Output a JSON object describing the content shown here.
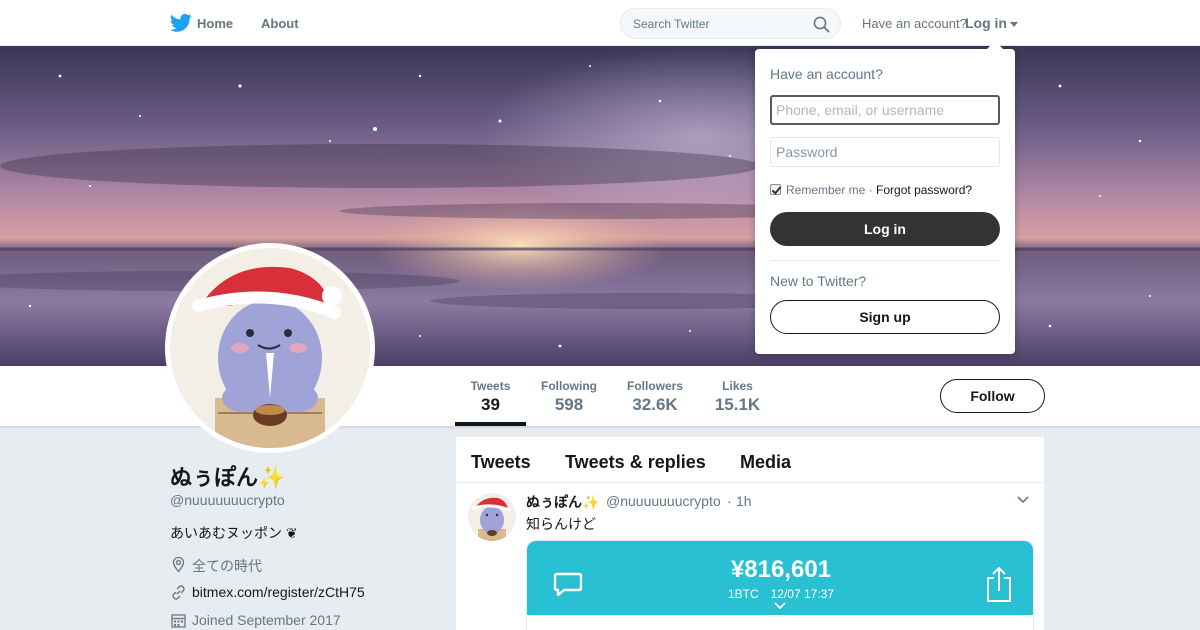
{
  "topbar": {
    "logo_icon": "twitter-bird-icon",
    "nav": [
      {
        "label": "Home"
      },
      {
        "label": "About"
      }
    ],
    "search_placeholder": "Search Twitter",
    "search_icon": "search-icon",
    "have_account": "Have an account?",
    "login_label": "Log in"
  },
  "login_dropdown": {
    "title": "Have an account?",
    "username_placeholder": "Phone, email, or username",
    "password_placeholder": "Password",
    "remember_me": "Remember me",
    "separator": "·",
    "forgot_password": "Forgot password?",
    "login_button": "Log in",
    "new_to_twitter": "New to Twitter?",
    "signup_button": "Sign up"
  },
  "profile_nav": {
    "stats": [
      {
        "label": "Tweets",
        "value": "39"
      },
      {
        "label": "Following",
        "value": "598"
      },
      {
        "label": "Followers",
        "value": "32.6K"
      },
      {
        "label": "Likes",
        "value": "15.1K"
      }
    ],
    "follow_button": "Follow"
  },
  "profile": {
    "name": "ぬぅぽん✨",
    "handle": "@nuuuuuuucrypto",
    "bio": "あいあむヌッポン ❦",
    "location": "全ての時代",
    "location_icon": "location-pin-icon",
    "url": "bitmex.com/register/zCtH75",
    "url_icon": "link-icon",
    "joined": "Joined September 2017",
    "joined_icon": "calendar-icon"
  },
  "timeline": {
    "tabs": [
      {
        "label": "Tweets"
      },
      {
        "label": "Tweets & replies"
      },
      {
        "label": "Media"
      }
    ],
    "tweet": {
      "name": "ぬぅぽん✨",
      "handle": "@nuuuuuuucrypto",
      "dot": "·",
      "time": "1h",
      "text": "知らんけど",
      "card": {
        "amount": "¥816,601",
        "sub": "1BTC　12/07 17:37",
        "bg_color": "#29c0d3"
      }
    }
  },
  "colors": {
    "primary_text": "#14171a",
    "secondary_text": "#657786",
    "page_bg": "#e6ecf0",
    "login_button_bg": "#333333",
    "twitter_blue": "#1da1f2"
  }
}
